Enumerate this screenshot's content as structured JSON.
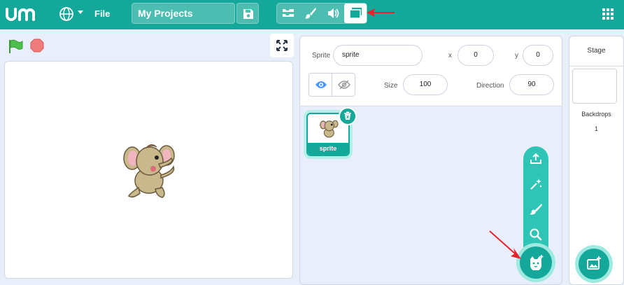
{
  "menubar": {
    "file_label": "File",
    "project_title": "My Projects"
  },
  "sprite_info": {
    "sprite_label": "Sprite",
    "sprite_name": "sprite",
    "x_label": "x",
    "x_value": "0",
    "y_label": "y",
    "y_value": "0",
    "size_label": "Size",
    "size_value": "100",
    "direction_label": "Direction",
    "direction_value": "90"
  },
  "sprite_list": [
    {
      "name": "sprite"
    }
  ],
  "stage_panel": {
    "title": "Stage",
    "backdrops_label": "Backdrops",
    "backdrops_count": "1"
  },
  "colors": {
    "accent": "#14a89a",
    "annotation_arrow": "#e8212b"
  },
  "icons": [
    "logo-icon",
    "globe-icon",
    "save-icon",
    "code-tab-icon",
    "costume-tab-icon",
    "sound-tab-icon",
    "stage-tab-icon",
    "grid-icon",
    "green-flag-icon",
    "stop-icon",
    "fullscreen-icon",
    "show-eye-icon",
    "hide-eye-icon",
    "delete-icon",
    "upload-icon",
    "surprise-icon",
    "paint-icon",
    "search-icon",
    "choose-sprite-icon",
    "choose-backdrop-icon"
  ]
}
